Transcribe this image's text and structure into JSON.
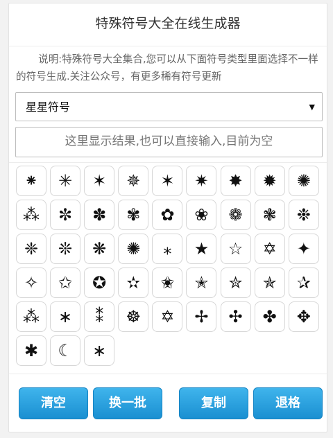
{
  "header": {
    "title": "特殊符号大全在线生成器"
  },
  "description": "说明:特殊符号大全集合,您可以从下面符号类型里面选择不一样的符号生成.关注公众号，有更多稀有符号更新",
  "category_select": {
    "selected": "星星符号"
  },
  "result_box": {
    "placeholder": "这里显示结果,也可以直接输入,目前为空",
    "value": ""
  },
  "symbols": [
    "⁕",
    "✳",
    "✶",
    "✵",
    "✶",
    "✷",
    "✸",
    "✹",
    "✺",
    "⁂",
    "✼",
    "✽",
    "✾",
    "✿",
    "❀",
    "❁",
    "❃",
    "❉",
    "❈",
    "❊",
    "❋",
    "✺",
    "⁎",
    "★",
    "☆",
    "✡",
    "✦",
    "✧",
    "✩",
    "✪",
    "✫",
    "✬",
    "✭",
    "✮",
    "✯",
    "✰",
    "⁂",
    "∗",
    "⁑",
    "☸",
    "✡",
    "✢",
    "✣",
    "✤",
    "✥",
    "✱",
    "☾",
    "∗"
  ],
  "buttons": {
    "clear": "清空",
    "refresh": "换一批",
    "copy": "复制",
    "backspace": "退格"
  }
}
